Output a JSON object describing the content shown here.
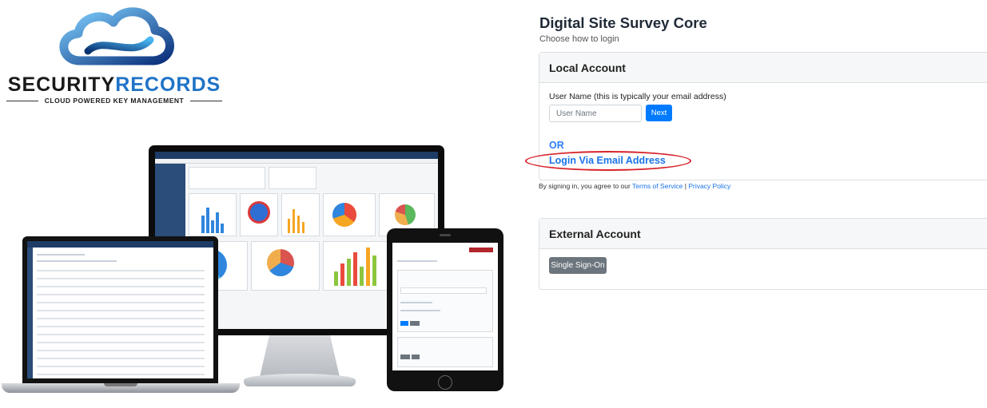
{
  "brand": {
    "name_part1": "SECURITY",
    "name_part2": "RECORDS",
    "tagline": "CLOUD POWERED KEY MANAGEMENT"
  },
  "login": {
    "title": "Digital Site Survey Core",
    "subtitle": "Choose how to login",
    "local_account": {
      "heading": "Local Account",
      "username_label": "User Name (this is typically your email address)",
      "username_placeholder": "User Name",
      "username_value": "",
      "next_label": "Next",
      "or_label": "OR",
      "email_login_label": "Login Via Email Address"
    },
    "terms": {
      "prefix": "By signing in, you agree to our",
      "terms_link": "Terms of Service",
      "separator": "|",
      "privacy_link": "Privacy Policy"
    },
    "external_account": {
      "heading": "External Account",
      "sso_label": "Single Sign-On"
    }
  },
  "colors": {
    "primary": "#007bff",
    "link": "#1a73e8",
    "highlight_ring": "#d8232a",
    "secondary_button": "#6c757d",
    "brand_blue": "#1f73c7"
  },
  "icons": [
    "cloud-logo-icon"
  ]
}
